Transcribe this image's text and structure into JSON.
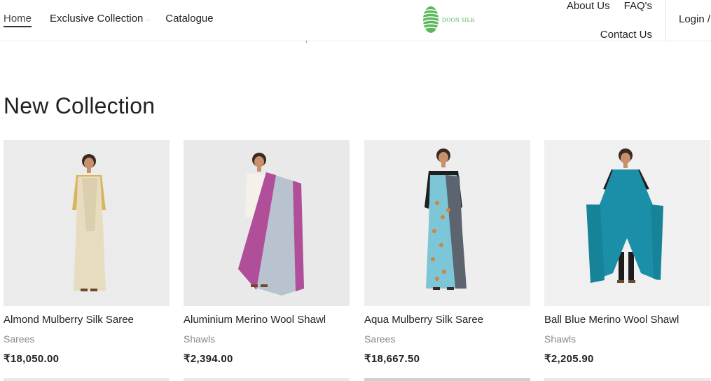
{
  "nav": {
    "home": "Home",
    "exclusive_collection": "Exclusive Collection",
    "catalogue": "Catalogue",
    "about_us": "About Us",
    "faqs": "FAQ's",
    "contact_us": "Contact Us",
    "login": "Login /"
  },
  "logo": {
    "text": "DOON SILK",
    "color": "#4caf50"
  },
  "section": {
    "title": "New Collection"
  },
  "products": [
    {
      "name": "Almond Mulberry Silk Saree",
      "category": "Sarees",
      "price": "₹18,050.00",
      "garment_color": "#e7dcc0"
    },
    {
      "name": "Aluminium Merino Wool Shawl",
      "category": "Shawls",
      "price": "₹2,394.00",
      "garment_color": "#b9c3cf",
      "accent_color": "#b04e9a"
    },
    {
      "name": "Aqua Mulberry Silk Saree",
      "category": "Sarees",
      "price": "₹18,667.50",
      "garment_color": "#7cc6d8",
      "accent_color": "#5c6470"
    },
    {
      "name": "Ball Blue Merino Wool Shawl",
      "category": "Shawls",
      "price": "₹2,205.90",
      "garment_color": "#1b8fa8"
    }
  ]
}
